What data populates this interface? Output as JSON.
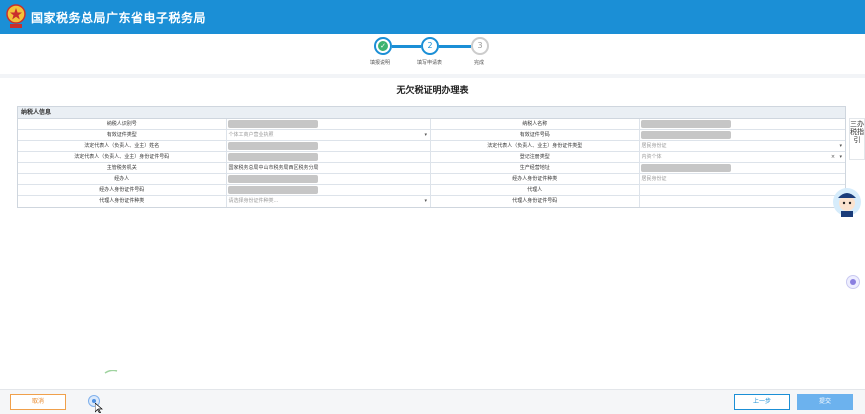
{
  "header": {
    "title": "国家税务总局广东省电子税务局",
    "bg_color": "#1b8fd6",
    "logo_icon": "tax-emblem-icon"
  },
  "steps": [
    {
      "label": "填报说明",
      "status": "done",
      "number": ""
    },
    {
      "label": "填写申请表",
      "status": "active",
      "number": "2"
    },
    {
      "label": "完成",
      "status": "pending",
      "number": "3"
    }
  ],
  "form": {
    "title": "无欠税证明办理表",
    "section": "纳税人信息",
    "rows": [
      [
        {
          "label": "纳税人识别号",
          "type": "masked"
        },
        {
          "label": "纳税人名称",
          "type": "masked"
        }
      ],
      [
        {
          "label": "有效证件类型",
          "type": "select",
          "value": "个体工商户营业执照"
        },
        {
          "label": "有效证件号码",
          "type": "masked"
        }
      ],
      [
        {
          "label": "法定代表人（负责人、业主）姓名",
          "type": "masked"
        },
        {
          "label": "法定代表人（负责人、业主）身份证件类型",
          "type": "select",
          "value": "居民身份证"
        }
      ],
      [
        {
          "label": "法定代表人（负责人、业主）身份证件号码",
          "type": "masked"
        },
        {
          "label": "登记注册类型",
          "type": "select-clear",
          "value": "内资个体"
        }
      ],
      [
        {
          "label": "主管税务机关",
          "type": "text",
          "value": "国家税务总局中山市税务局西区税务分局"
        },
        {
          "label": "生产经营地址",
          "type": "masked"
        }
      ],
      [
        {
          "label": "经办人",
          "type": "masked"
        },
        {
          "label": "经办人身份证件种类",
          "type": "text-muted",
          "value": "居民身份证"
        }
      ],
      [
        {
          "label": "经办人身份证件号码",
          "type": "masked"
        },
        {
          "label": "代理人",
          "type": "empty"
        }
      ],
      [
        {
          "label": "代理人身份证件种类",
          "type": "select",
          "value": "请选择身份证件种类..."
        },
        {
          "label": "代理人身份证件号码",
          "type": "empty"
        }
      ]
    ]
  },
  "side": {
    "guide_label": "三办税指引",
    "assistant_icon": "tax-assistant-avatar-icon"
  },
  "footer": {
    "cancel_label": "取消",
    "prev_label": "上一步",
    "submit_label": "提交"
  },
  "colors": {
    "accent": "#1b8fd6",
    "cancel": "#e8892b",
    "submit": "#6cb2ee",
    "done": "#3cb371"
  }
}
